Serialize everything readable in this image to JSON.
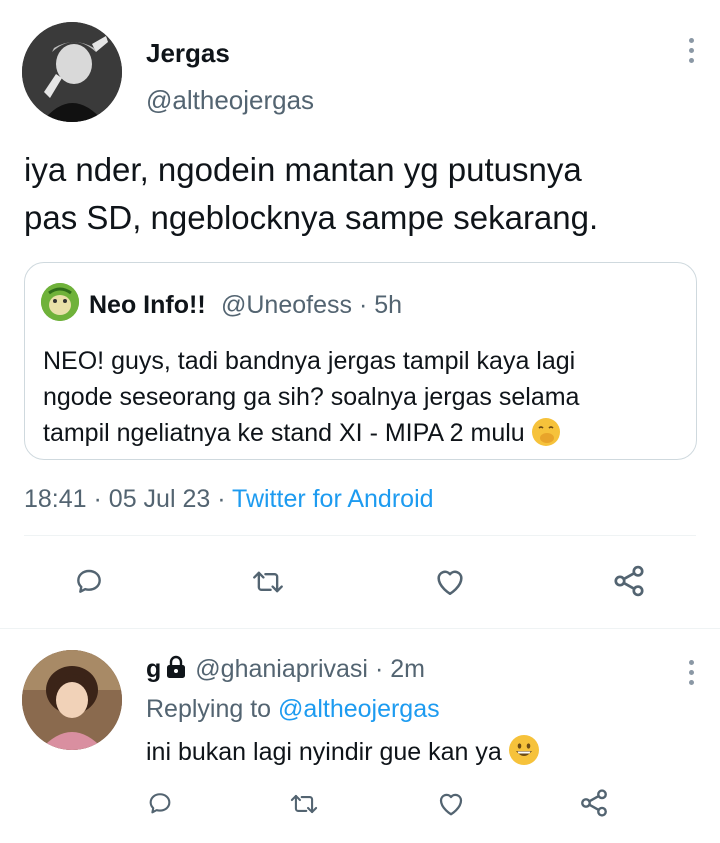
{
  "tweet": {
    "author_name": "Jergas",
    "author_handle": "@altheojergas",
    "text_line1": "iya nder, ngodein mantan yg putusnya",
    "text_line2": "pas SD, ngeblocknya sampe sekarang.",
    "time": "18:41",
    "date": "05 Jul 23",
    "source": "Twitter for Android",
    "separator": "·"
  },
  "quote": {
    "name": "Neo Info!!",
    "handle": "@Uneofess",
    "age": "5h",
    "line1": "NEO! guys, tadi bandnya jergas tampil kaya lagi",
    "line2": "ngode seseorang ga sih? soalnya jergas selama",
    "line3": "tampil ngeliatnya ke stand XI - MIPA 2 mulu",
    "emoji": "face-with-hand-over-mouth"
  },
  "reply": {
    "name": "g",
    "handle": "@ghaniaprivasi",
    "age": "2m",
    "replying_prefix": "Replying to",
    "replying_to": "@altheojergas",
    "text": "ini bukan lagi nyindir gue kan ya",
    "emoji": "grinning-face"
  },
  "icons": {
    "actions": [
      "reply-icon",
      "retweet-icon",
      "like-icon",
      "share-icon"
    ],
    "more": "more-vertical-icon",
    "lock": "lock-icon"
  },
  "colors": {
    "link": "#1d9bf0",
    "secondary_text": "#536471",
    "icon": "#536471",
    "divider": "#eff3f4"
  }
}
